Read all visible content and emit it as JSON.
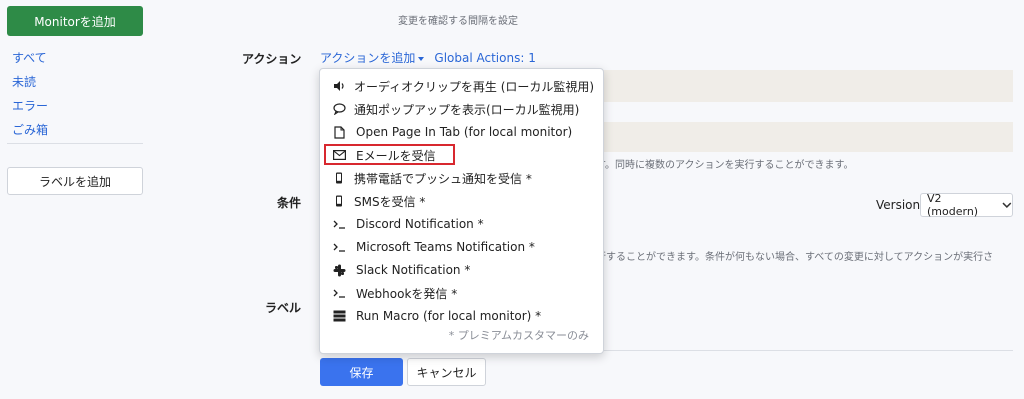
{
  "sidebar": {
    "add_monitor": "Monitorを追加",
    "nav": [
      "すべて",
      "未読",
      "エラー",
      "ごみ箱"
    ],
    "add_label": "ラベルを追加"
  },
  "main": {
    "interval_hint": "変更を確認する間隔を設定",
    "actions_label": "アクション",
    "add_action_link": "アクションを追加",
    "global_actions_link": "Global Actions: 1",
    "actions_hint": "す。同時に複数のアクションを実行することができます。",
    "conditions_label": "条件",
    "conditions_hint": "行することができます。条件が何もない場合、すべての変更に対してアクションが実行さ",
    "version_label": "Version",
    "version_value": "V2 (modern)",
    "label_label": "ラベル",
    "save": "保存",
    "cancel": "キャンセル"
  },
  "dropdown": {
    "items": [
      {
        "icon": "speaker-icon",
        "label": "オーディオクリップを再生 (ローカル監視用)"
      },
      {
        "icon": "speech-bubble-icon",
        "label": "通知ポップアップを表示(ローカル監視用)"
      },
      {
        "icon": "document-icon",
        "label": "Open Page In Tab (for local monitor)"
      },
      {
        "icon": "envelope-icon",
        "label": "Eメールを受信"
      },
      {
        "icon": "mobile-icon",
        "label": "携帯電話でプッシュ通知を受信 *"
      },
      {
        "icon": "mobile-icon",
        "label": "SMSを受信 *"
      },
      {
        "icon": "terminal-icon",
        "label": "Discord Notification *"
      },
      {
        "icon": "terminal-icon",
        "label": "Microsoft Teams Notification *"
      },
      {
        "icon": "slack-icon",
        "label": "Slack Notification *"
      },
      {
        "icon": "terminal-icon",
        "label": "Webhookを発信 *"
      },
      {
        "icon": "macro-icon",
        "label": "Run Macro (for local monitor) *"
      }
    ],
    "premium_note": "* プレミアムカスタマーのみ"
  },
  "colors": {
    "primary_green": "#2e8b47",
    "primary_blue": "#3a73ee",
    "link_blue": "#2a66d6",
    "highlight_red": "#d8282f"
  }
}
